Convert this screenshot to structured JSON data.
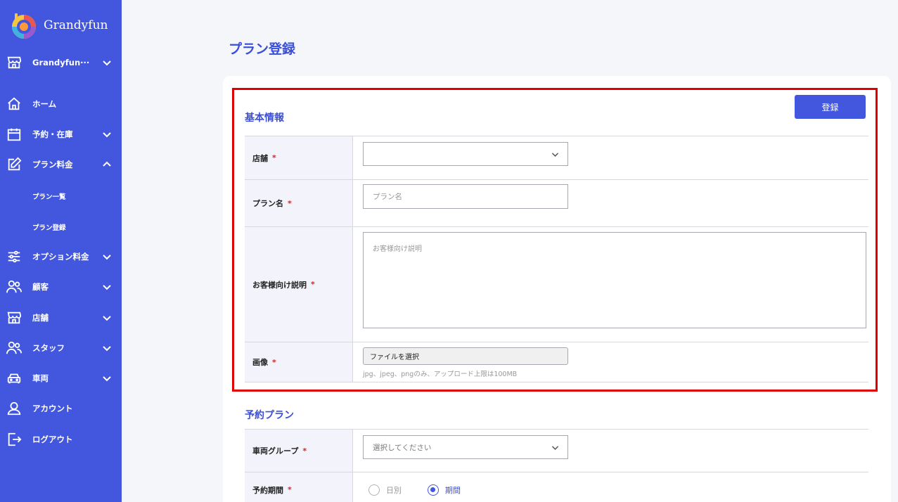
{
  "sidebar": {
    "brand": "Grandyfun",
    "store_selector": "Grandyfun···",
    "items": [
      {
        "label": "ホーム"
      },
      {
        "label": "予約・在庫"
      },
      {
        "label": "プラン料金"
      },
      {
        "label": "オプション料金"
      },
      {
        "label": "顧客"
      },
      {
        "label": "店舗"
      },
      {
        "label": "スタッフ"
      },
      {
        "label": "車両"
      },
      {
        "label": "アカウント"
      },
      {
        "label": "ログアウト"
      }
    ],
    "sub_items": [
      {
        "label": "プラン一覧"
      },
      {
        "label": "プラン登録"
      }
    ]
  },
  "page": {
    "title": "プラン登録",
    "register_button": "登録"
  },
  "basic_info": {
    "title": "基本情報",
    "store_label": "店舗",
    "plan_name_label": "プラン名",
    "plan_name_placeholder": "プラン名",
    "description_label": "お客様向け説明",
    "description_placeholder": "お客様向け説明",
    "image_label": "画像",
    "file_button": "ファイルを選択",
    "file_hint": "jpg、jpeg、pngのみ、アップロード上限は100MB"
  },
  "reservation_plan": {
    "title": "予約プラン",
    "vehicle_group_label": "車両グループ",
    "vehicle_group_placeholder": "選択してください",
    "period_label": "予約期間",
    "options": [
      "日別",
      "期間"
    ],
    "selected": "期間"
  },
  "required_mark": "*",
  "colors": {
    "sidebar": "#4356de",
    "accent": "#3b4fd8",
    "required": "#e02020",
    "highlight": "#e00000"
  }
}
